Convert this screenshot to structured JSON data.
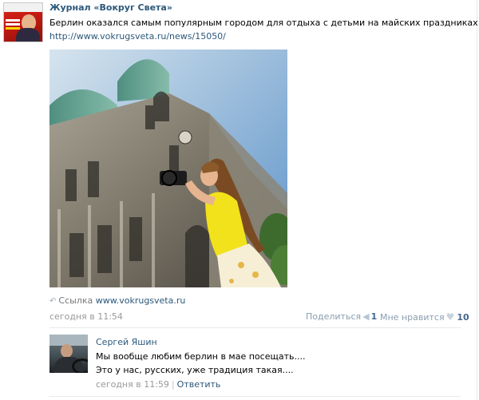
{
  "post": {
    "group_name": "Журнал «Вокруг Света»",
    "text": "Берлин оказался самым популярным городом для отдыха с детьми на майских праздниках",
    "link": "http://www.vokrugsveta.ru/news/15050/",
    "share_link_prefix": "Ссылка",
    "share_link_domain": "www.vokrugsveta.ru",
    "time": "сегодня в 11:54",
    "share_label": "Поделиться",
    "share_count": "1",
    "like_label": "Мне нравится",
    "like_count": "10",
    "icons": {
      "share": "megaphone-icon",
      "like": "heart-icon",
      "link": "link-arrow-icon"
    }
  },
  "comment": {
    "author": "Сергей Яшин",
    "line1": "Мы вообще любим берлин в мае посещать....",
    "line2": "Это у нас, русских, уже традиция такая....",
    "time": "сегодня в 11:59",
    "separator": "|",
    "reply_label": "Ответить"
  },
  "colors": {
    "link": "#2b587a",
    "muted": "#999999",
    "count": "#45688e",
    "divider": "#e7eaed"
  }
}
